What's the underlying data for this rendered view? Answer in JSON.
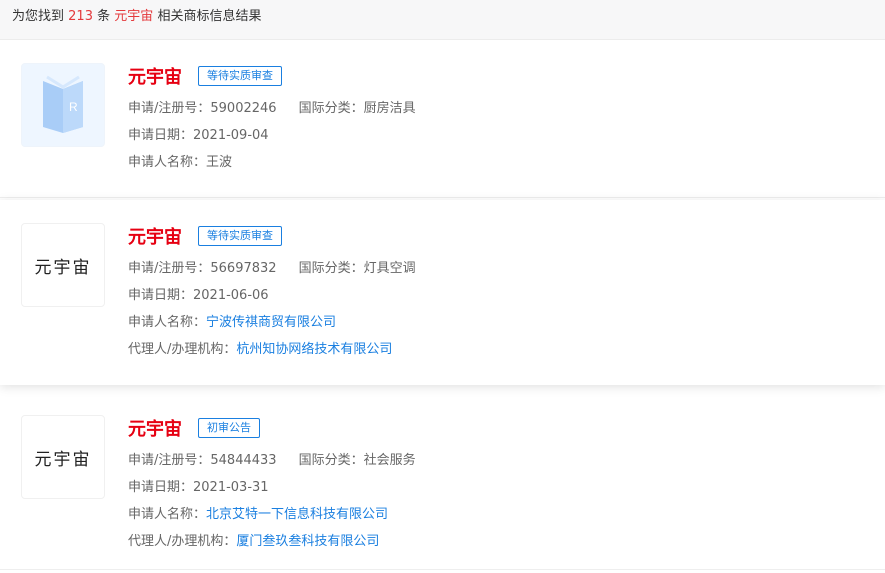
{
  "summary": {
    "prefix": "为您找到",
    "count": "213",
    "unit": "条",
    "keyword": "元宇宙",
    "suffix": "相关商标信息结果"
  },
  "labels": {
    "reg_no": "申请/注册号：",
    "intl_class": "国际分类：",
    "apply_date": "申请日期：",
    "applicant": "申请人名称：",
    "agent": "代理人/办理机构："
  },
  "results": [
    {
      "name": "元宇宙",
      "status": "等待实质审查",
      "reg_no": "59002246",
      "intl_class": "厨房洁具",
      "apply_date": "2021-09-04",
      "applicant": "王波"
    },
    {
      "name": "元宇宙",
      "logo_text": "元宇宙",
      "status": "等待实质审查",
      "reg_no": "56697832",
      "intl_class": "灯具空调",
      "apply_date": "2021-06-06",
      "applicant": "宁波传祺商贸有限公司",
      "agent": "杭州知协网络技术有限公司"
    },
    {
      "name": "元宇宙",
      "logo_text": "元宇宙",
      "status": "初审公告",
      "reg_no": "54844433",
      "intl_class": "社会服务",
      "apply_date": "2021-03-31",
      "applicant": "北京艾特一下信息科技有限公司",
      "agent": "厦门叁玖叁科技有限公司"
    }
  ]
}
